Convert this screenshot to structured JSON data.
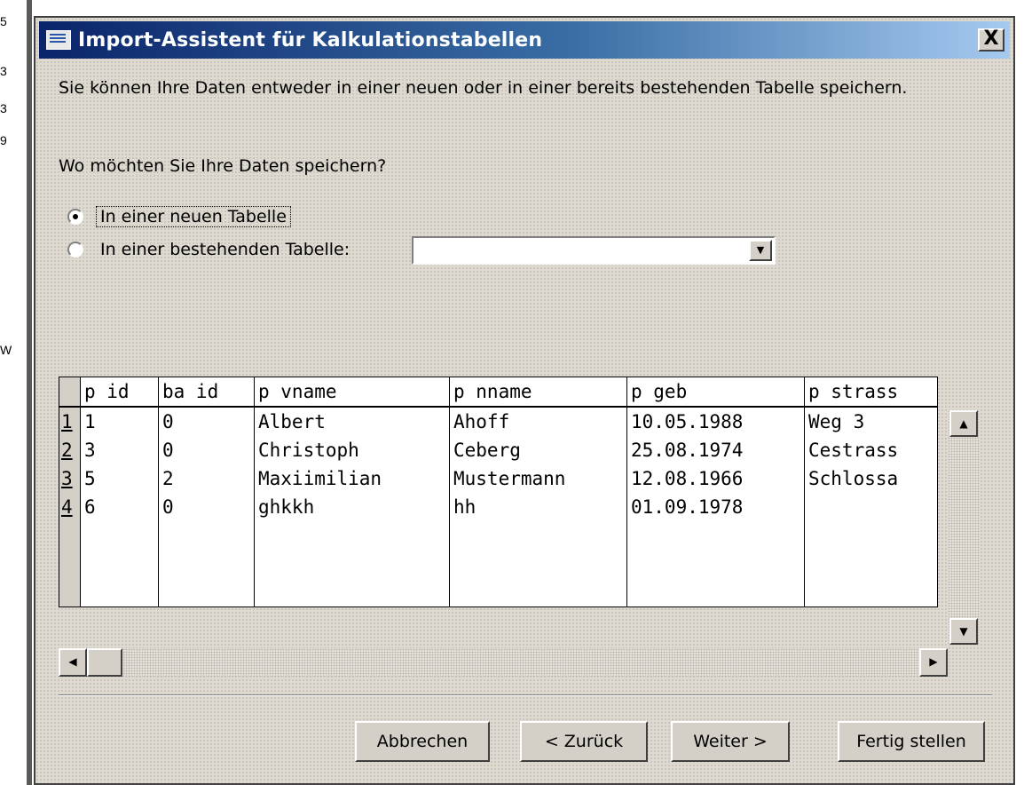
{
  "left_strip": {
    "chars": [
      "5",
      "3",
      "3",
      "9",
      "W"
    ]
  },
  "dialog": {
    "title": "Import-Assistent für Kalkulationstabellen",
    "close_label": "X",
    "intro_text": "Sie können Ihre Daten entweder in einer neuen oder in einer bereits bestehenden Tabelle speichern.",
    "question": "Wo möchten Sie Ihre Daten speichern?",
    "options": {
      "new_table": {
        "label": "In einer neuen Tabelle",
        "checked": true
      },
      "existing_table": {
        "label": "In einer bestehenden Tabelle:",
        "checked": false
      }
    },
    "existing_table_select": {
      "value": ""
    }
  },
  "grid": {
    "columns": [
      "p id",
      "ba id",
      "p vname",
      "p nname",
      "p geb",
      "p strass"
    ],
    "rows": [
      {
        "num": "1",
        "cells": [
          "1",
          "0",
          "Albert",
          "Ahoff",
          "10.05.1988",
          "Weg 3"
        ]
      },
      {
        "num": "2",
        "cells": [
          "3",
          "0",
          "Christoph",
          "Ceberg",
          "25.08.1974",
          "Cestrass"
        ]
      },
      {
        "num": "3",
        "cells": [
          "5",
          "2",
          "Maxiimilian",
          "Mustermann",
          "12.08.1966",
          "Schlossa"
        ]
      },
      {
        "num": "4",
        "cells": [
          "6",
          "0",
          "ghkkh",
          "hh",
          "01.09.1978",
          ""
        ]
      },
      {
        "num": "",
        "cells": [
          "",
          "",
          "",
          "",
          "",
          ""
        ]
      },
      {
        "num": "",
        "cells": [
          "",
          "",
          "",
          "",
          "",
          ""
        ]
      },
      {
        "num": "",
        "cells": [
          "",
          "",
          "",
          "",
          "",
          ""
        ]
      }
    ]
  },
  "buttons": {
    "cancel": "Abbrechen",
    "back": "< Zurück",
    "next": "Weiter >",
    "finish": "Fertig stellen"
  },
  "icons": {
    "title": "table-icon",
    "scroll_up": "arrow-up-icon",
    "scroll_down": "arrow-down-icon",
    "scroll_left": "arrow-left-icon",
    "scroll_right": "arrow-right-icon",
    "dropdown": "chevron-down-icon"
  },
  "colors": {
    "title_gradient_start": "#0a246a",
    "title_gradient_end": "#a6caf0",
    "dialog_bg": "#dedad2"
  }
}
